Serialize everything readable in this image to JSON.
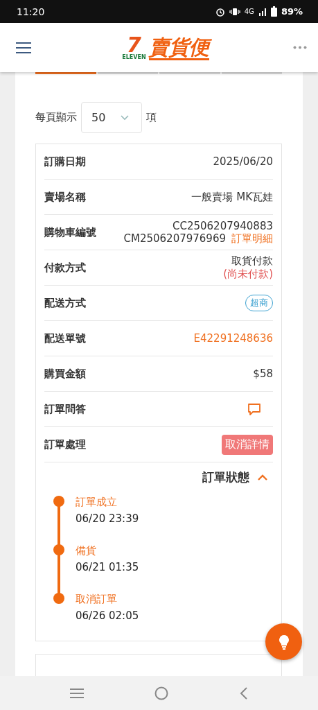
{
  "status_bar": {
    "time": "11:20",
    "network": "4G",
    "battery": "89%"
  },
  "header": {
    "logo_mark": "7",
    "logo_sub": "ELEVEN",
    "logo_title": "賣貨便"
  },
  "tabs": [
    {
      "selected": true
    },
    {
      "selected": false
    },
    {
      "selected": false
    },
    {
      "selected": false
    }
  ],
  "page_size": {
    "label": "每頁顯示",
    "value": "50",
    "unit": "項"
  },
  "order": {
    "rows": [
      {
        "kind": "text",
        "label": "訂購日期",
        "value": "2025/06/20"
      },
      {
        "kind": "text",
        "label": "賣場名稱",
        "value": "一般賣場 MK瓦娃"
      },
      {
        "kind": "cart",
        "label": "購物車編號",
        "lines": [
          "CC2506207940883",
          "CM2506207976969"
        ],
        "link": "訂單明細"
      },
      {
        "kind": "payment",
        "label": "付款方式",
        "value": "取貨付款",
        "note": "(尚未付款)"
      },
      {
        "kind": "tag",
        "label": "配送方式",
        "value": "超商"
      },
      {
        "kind": "link",
        "label": "配送單號",
        "value": "E42291248636"
      },
      {
        "kind": "text",
        "label": "購買金額",
        "value": "$58"
      },
      {
        "kind": "chat",
        "label": "訂單問答"
      },
      {
        "kind": "button",
        "label": "訂單處理",
        "value": "取消詳情"
      }
    ],
    "status": {
      "title": "訂單狀態",
      "expanded": true,
      "steps": [
        {
          "name": "訂單成立",
          "time": "06/20 23:39"
        },
        {
          "name": "備貨",
          "time": "06/21 01:35"
        },
        {
          "name": "取消訂單",
          "time": "06/26 02:05"
        }
      ]
    }
  }
}
